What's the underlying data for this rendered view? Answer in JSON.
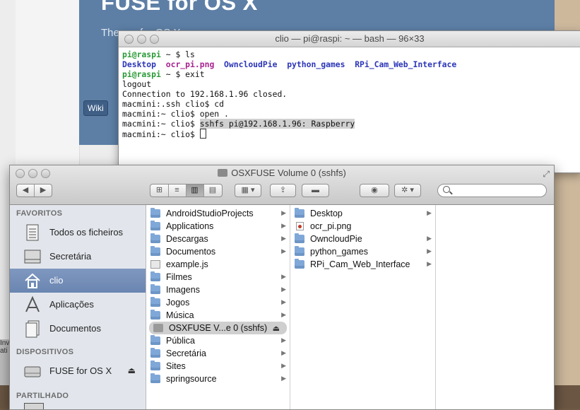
{
  "background": {
    "hero_title": "FUSE for OS X",
    "hero_subtitle": "The...          ...for OS X",
    "wiki_button": "Wiki",
    "left_strip": "Inv\nati"
  },
  "terminal": {
    "title": "clio — pi@raspi: ~ — bash — 96×33",
    "lines": {
      "l1_prompt": "pi@raspi",
      "l1_rest": " ~ $ ls",
      "l2_a": "Desktop",
      "l2_b": "ocr_pi.png",
      "l2_c": "OwncloudPie",
      "l2_d": "python_games",
      "l2_e": "RPi_Cam_Web_Interface",
      "l3_prompt": "pi@raspi",
      "l3_rest": " ~ $ exit",
      "l4": "logout",
      "l5": "Connection to 192.168.1.96 closed.",
      "l6": "macmini:.ssh clio$ cd",
      "l7": "macmini:~ clio$ open .",
      "l8_prefix": "macmini:~ clio$ ",
      "l8_selected": "sshfs pi@192.168.1.96: Raspberry",
      "l9": "macmini:~ clio$ "
    }
  },
  "finder": {
    "title": "OSXFUSE Volume 0 (sshfs)",
    "sidebar": {
      "favorites_header": "FAVORITOS",
      "devices_header": "DISPOSITIVOS",
      "shared_header": "PARTILHADO",
      "favorites": [
        {
          "label": "Todos os ficheiros",
          "icon": "all-files-icon"
        },
        {
          "label": "Secretária",
          "icon": "desktop-icon"
        },
        {
          "label": "clio",
          "icon": "home-icon"
        },
        {
          "label": "Aplicações",
          "icon": "applications-icon"
        },
        {
          "label": "Documentos",
          "icon": "documents-icon"
        }
      ],
      "devices": [
        {
          "label": "FUSE for OS X",
          "icon": "disk-icon"
        }
      ]
    },
    "column1": [
      {
        "label": "AndroidStudioProjects",
        "type": "folder"
      },
      {
        "label": "Applications",
        "type": "folder"
      },
      {
        "label": "Descargas",
        "type": "folder"
      },
      {
        "label": "Documentos",
        "type": "folder"
      },
      {
        "label": "example.js",
        "type": "file"
      },
      {
        "label": "Filmes",
        "type": "folder"
      },
      {
        "label": "Imagens",
        "type": "folder"
      },
      {
        "label": "Jogos",
        "type": "folder"
      },
      {
        "label": "Música",
        "type": "folder"
      },
      {
        "label": "OSXFUSE V...e 0 (sshfs)",
        "type": "volume"
      },
      {
        "label": "Pública",
        "type": "folder"
      },
      {
        "label": "Secretária",
        "type": "folder"
      },
      {
        "label": "Sites",
        "type": "folder"
      },
      {
        "label": "springsource",
        "type": "folder"
      }
    ],
    "column2": [
      {
        "label": "Desktop",
        "type": "folder"
      },
      {
        "label": "ocr_pi.png",
        "type": "png"
      },
      {
        "label": "OwncloudPie",
        "type": "folder"
      },
      {
        "label": "python_games",
        "type": "folder"
      },
      {
        "label": "RPi_Cam_Web_Interface",
        "type": "folder"
      }
    ]
  }
}
